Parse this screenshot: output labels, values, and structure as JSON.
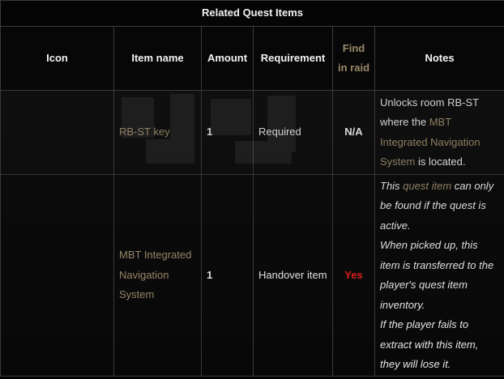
{
  "table": {
    "caption": "Related Quest Items",
    "headers": {
      "icon": "Icon",
      "item_name": "Item name",
      "amount": "Amount",
      "requirement": "Requirement",
      "find_in_raid": "Find in raid",
      "notes": "Notes"
    },
    "rows": [
      {
        "icon": "",
        "item_name": "RB-ST key",
        "amount": "1",
        "requirement": "Required",
        "find_in_raid": "N/A",
        "notes": {
          "part1": "Unlocks room RB-ST where the ",
          "link": "MBT Integrated Navigation System",
          "part2": " is located."
        }
      },
      {
        "icon": "",
        "item_name": "MBT Integrated Navigation System",
        "amount": "1",
        "requirement": "Handover item",
        "find_in_raid": "Yes",
        "notes": {
          "part1": "This ",
          "link": "quest item",
          "part2": " can only be found if the quest is active.",
          "line2": "When picked up, this item is transferred to the player's quest item inventory.",
          "line3": "If the player fails to extract with this item, they will lose it."
        }
      }
    ]
  },
  "colors": {
    "link": "#9b8a6a",
    "yes": "#e51b1b",
    "border": "#3a3a3a",
    "background": "#000000"
  }
}
